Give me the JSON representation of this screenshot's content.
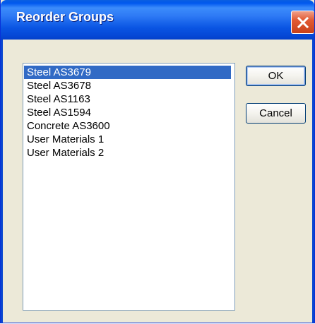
{
  "window": {
    "title": "Reorder Groups",
    "close_icon": "close-icon"
  },
  "list": {
    "items": [
      {
        "label": "Steel AS3679",
        "selected": true
      },
      {
        "label": "Steel AS3678",
        "selected": false
      },
      {
        "label": "Steel AS1163",
        "selected": false
      },
      {
        "label": "Steel AS1594",
        "selected": false
      },
      {
        "label": "Concrete AS3600",
        "selected": false
      },
      {
        "label": "User Materials 1",
        "selected": false
      },
      {
        "label": "User Materials 2",
        "selected": false
      }
    ]
  },
  "buttons": {
    "ok_label": "OK",
    "cancel_label": "Cancel"
  },
  "colors": {
    "title_bar": "#0058ee",
    "selection": "#316ac5",
    "close_button": "#e25a33",
    "dialog_background": "#ece9d8"
  }
}
